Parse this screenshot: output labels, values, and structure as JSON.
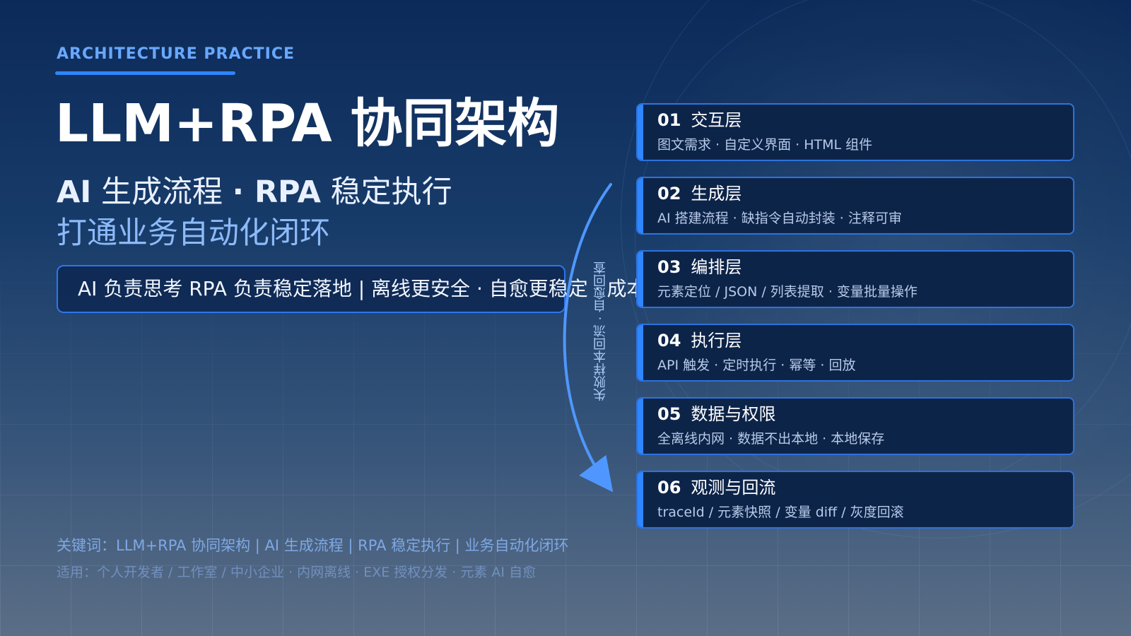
{
  "header": {
    "eyebrow": "ARCHITECTURE PRACTICE",
    "title_en": "LLM+RPA ",
    "title_cn": "协同架构",
    "subtitle_line1_part1": "AI",
    "subtitle_line1_part2": " 生成流程 ",
    "subtitle_line1_part3": "·",
    "subtitle_line1_part4": " RPA",
    "subtitle_line1_part5": " 稳定执行",
    "subtitle_line2": "打通业务自动化闭环"
  },
  "summary": {
    "text": "AI 负责思考   RPA 负责稳定落地   |   离线更安全 · 自愈更稳定 · 成本透明"
  },
  "feedback_loop": {
    "label": "失败样本回流 · 自愈回查",
    "arrow_color": "#4f97ff"
  },
  "layers": [
    {
      "number": "01",
      "name": "交互层",
      "description": "图文需求 · 自定义界面 · HTML 组件"
    },
    {
      "number": "02",
      "name": "生成层",
      "description": "AI 搭建流程 · 缺指令自动封装 · 注释可审"
    },
    {
      "number": "03",
      "name": "编排层",
      "description": "元素定位 / JSON / 列表提取 · 变量批量操作"
    },
    {
      "number": "04",
      "name": "执行层",
      "description": "API 触发 · 定时执行 · 幂等 · 回放"
    },
    {
      "number": "05",
      "name": "数据与权限",
      "description": "全离线内网 · 数据不出本地 · 本地保存"
    },
    {
      "number": "06",
      "name": "观测与回流",
      "description": "traceId / 元素快照 / 变量 diff / 灰度回滚"
    }
  ],
  "footer": {
    "keywords": "关键词：LLM+RPA 协同架构  |  AI 生成流程  |  RPA 稳定执行  |  业务自动化闭环",
    "applicable": "适用：个人开发者 / 工作室 / 中小企业   ·   内网离线 · EXE 授权分发 · 元素 AI 自愈"
  },
  "colors": {
    "accent": "#2f86ff",
    "eyebrow": "#69a8ff",
    "card_bg": "#0d2449",
    "card_border": "#2d72dc",
    "subtitle_blue": "#8dbaf8",
    "footer_blue": "#7ea8e4"
  }
}
